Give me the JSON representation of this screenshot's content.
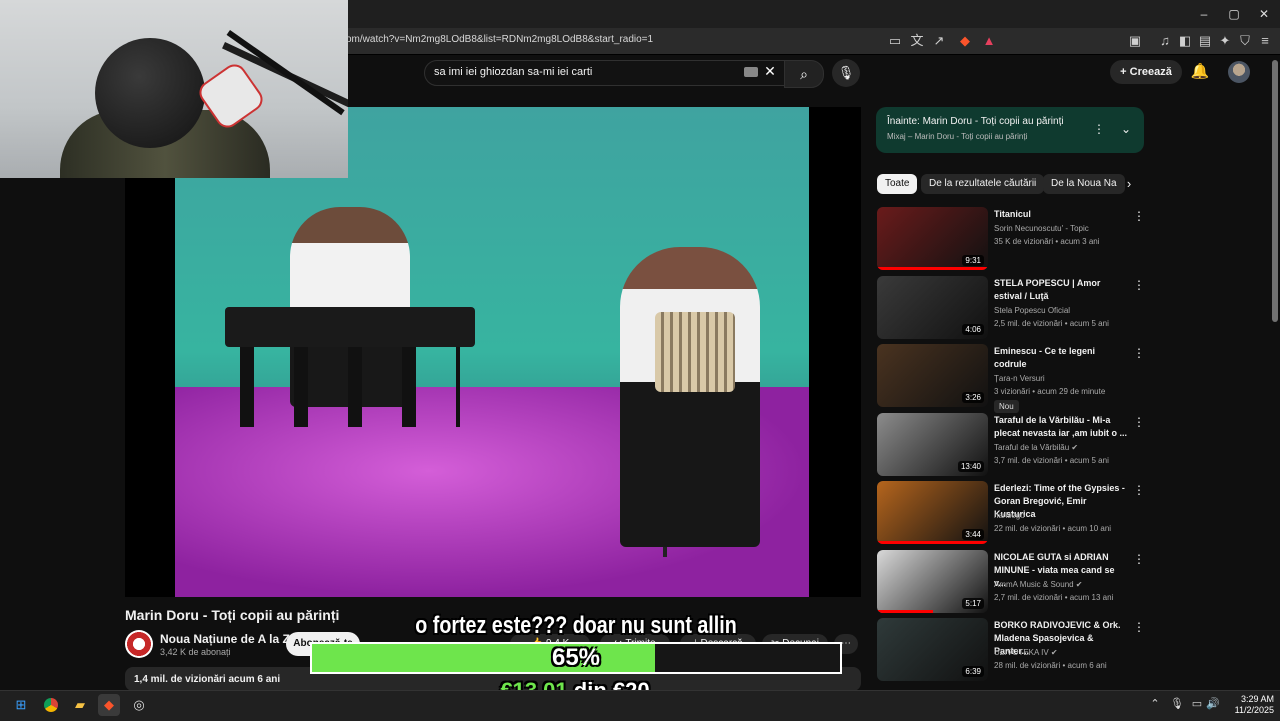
{
  "browser": {
    "url": "om/watch?v=Nm2mg8LOdB8&list=RDNm2mg8LOdB8&start_radio=1",
    "window_controls": [
      "–",
      "▢",
      "✕"
    ]
  },
  "header": {
    "search_query": "sa imi iei ghiozdan sa-mi iei carti",
    "create_label": "Creează"
  },
  "video": {
    "title": "Marin Doru - Toți copii au părinți",
    "channel": "Noua Națiune de A la Z",
    "subscribers": "3,42 K de abonați",
    "subscribe_label": "Abonează-te",
    "likes": "9,4 K",
    "share_label": "Trimite",
    "download_label": "Descarcă",
    "clip_label": "Decupaj",
    "views_line": "1,4 mil. de vizionări  acum 6 ani"
  },
  "overlay": {
    "caption": "o fortez este??? doar nu sunt allin",
    "goal_percent_text": "65%",
    "goal_fraction": 0.65,
    "goal_current": "€13.01",
    "goal_separator": "din",
    "goal_target": "€20"
  },
  "up_next": {
    "title": "Înainte: Marin Doru - Toți copii au părinți",
    "subtitle": "Mixaj – Marin Doru - Toți copii au părinți"
  },
  "chips": [
    "Toate",
    "De la rezultatele căutării",
    "De la Noua Na"
  ],
  "recommendations": [
    {
      "title": "Titanicul",
      "channel": "Sorin Necunoscutu' - Topic",
      "stats": "35 K de vizionări • acum 3 ani",
      "duration": "9:31",
      "thumb": "#6a1b1b",
      "progress": 1.0
    },
    {
      "title": "STELA POPESCU | Amor estival / Luţă",
      "channel": "Stela Popescu Oficial",
      "stats": "2,5 mil. de vizionări • acum 5 ani",
      "duration": "4:06",
      "thumb": "#3a3a3a",
      "progress": 0
    },
    {
      "title": "Eminescu  - Ce te legeni codrule",
      "channel": "Țara-n Versuri",
      "stats": "3 vizionări • acum 29 de minute",
      "duration": "3:26",
      "thumb": "#4a3320",
      "progress": 0,
      "badge": "Nou"
    },
    {
      "title": "Taraful de la Vărbilău - Mi-a plecat nevasta iar ,am iubit o ...",
      "channel": "Taraful de la Vărbilău ✔",
      "stats": "3,7 mil. de vizionări • acum 5 ani",
      "duration": "13:40",
      "thumb": "#8c8c8c",
      "progress": 0
    },
    {
      "title": "Ederlezi: Time of the Gypsies - Goran Bregović, Emir Kusturica",
      "channel": "harisego",
      "stats": "22 mil. de vizionări • acum 10 ani",
      "duration": "3:44",
      "thumb": "#b5651d",
      "progress": 1.0
    },
    {
      "title": "NICOLAE GUTA si ADRIAN MINUNE - viata mea cand se v...",
      "channel": "AmmA Music & Sound ✔",
      "stats": "2,7 mil. de vizionări • acum 13 ani",
      "duration": "5:17",
      "thumb": "#d9d9d9",
      "progress": 0.5
    },
    {
      "title": "BORKO RADIVOJEVIC & Ork. Mladena Spasojevica & Panter...",
      "channel": "UZIVOTEKA IV ✔",
      "stats": "28 mil. de vizionări • acum 6 ani",
      "duration": "6:39",
      "thumb": "#2f3a3a",
      "progress": 0
    }
  ],
  "taskbar": {
    "time": "3:29 AM",
    "date": "11/2/2025"
  },
  "colors": {
    "accent_green": "#6ee54c",
    "upnext_bg": "#0f3a2f",
    "progress_red": "#ff0000"
  }
}
